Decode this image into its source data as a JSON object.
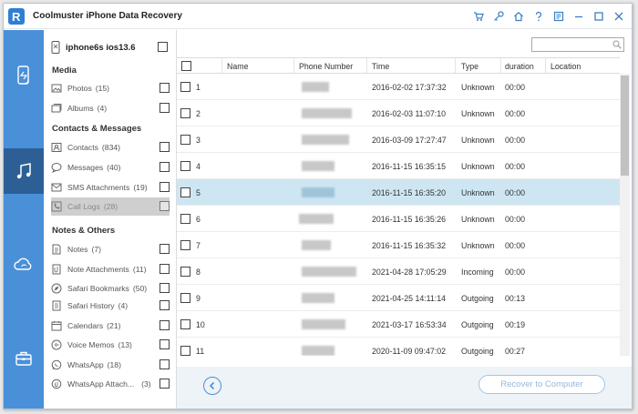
{
  "window": {
    "title": "Coolmuster iPhone Data Recovery"
  },
  "titlebar_icons": [
    "cart-icon",
    "key-icon",
    "home-icon",
    "help-icon",
    "feedback-icon",
    "minimize-icon",
    "maximize-icon",
    "close-icon"
  ],
  "leftbar": {
    "items": [
      "ios-device-icon",
      "music-itunes-icon",
      "cloud-icon",
      "toolbox-icon"
    ],
    "active": 1
  },
  "sidebar": {
    "device": "iphone6s ios13.6",
    "sections": [
      {
        "title": "Media",
        "items": [
          {
            "label": "Photos",
            "count": "(15)",
            "icon": "photos-icon"
          },
          {
            "label": "Albums",
            "count": "(4)",
            "icon": "albums-icon"
          }
        ]
      },
      {
        "title": "Contacts & Messages",
        "items": [
          {
            "label": "Contacts",
            "count": "(834)",
            "icon": "contacts-icon"
          },
          {
            "label": "Messages",
            "count": "(40)",
            "icon": "messages-icon"
          },
          {
            "label": "SMS Attachments",
            "count": "(19)",
            "icon": "sms-attachments-icon"
          },
          {
            "label": "Call Logs",
            "count": "(28)",
            "icon": "call-logs-icon",
            "selected": true
          }
        ]
      },
      {
        "title": "Notes & Others",
        "items": [
          {
            "label": "Notes",
            "count": "(7)",
            "icon": "notes-icon"
          },
          {
            "label": "Note Attachments",
            "count": "(11)",
            "icon": "note-attachments-icon"
          },
          {
            "label": "Safari Bookmarks",
            "count": "(50)",
            "icon": "safari-bookmarks-icon"
          },
          {
            "label": "Safari History",
            "count": "(4)",
            "icon": "safari-history-icon"
          },
          {
            "label": "Calendars",
            "count": "(21)",
            "icon": "calendars-icon"
          },
          {
            "label": "Voice Memos",
            "count": "(13)",
            "icon": "voice-memos-icon"
          },
          {
            "label": "WhatsApp",
            "count": "(18)",
            "icon": "whatsapp-icon"
          },
          {
            "label": "WhatsApp Attach...",
            "count": "(3)",
            "icon": "whatsapp-attachments-icon"
          }
        ]
      }
    ]
  },
  "table": {
    "columns": [
      "Name",
      "Phone Number",
      "Time",
      "Type",
      "duration",
      "Location"
    ],
    "rows": [
      {
        "num": "1",
        "name": "",
        "time": "2016-02-02 17:37:32",
        "type": "Unknown",
        "duration": "00:00",
        "location": ""
      },
      {
        "num": "2",
        "name": "",
        "time": "2016-02-03 11:07:10",
        "type": "Unknown",
        "duration": "00:00",
        "location": ""
      },
      {
        "num": "3",
        "name": "",
        "time": "2016-03-09 17:27:47",
        "type": "Unknown",
        "duration": "00:00",
        "location": ""
      },
      {
        "num": "4",
        "name": "",
        "time": "2016-11-15 16:35:15",
        "type": "Unknown",
        "duration": "00:00",
        "location": ""
      },
      {
        "num": "5",
        "name": "",
        "time": "2016-11-15 16:35:20",
        "type": "Unknown",
        "duration": "00:00",
        "location": "",
        "selected": true
      },
      {
        "num": "6",
        "name": "",
        "time": "2016-11-15 16:35:26",
        "type": "Unknown",
        "duration": "00:00",
        "location": ""
      },
      {
        "num": "7",
        "name": "",
        "time": "2016-11-15 16:35:32",
        "type": "Unknown",
        "duration": "00:00",
        "location": ""
      },
      {
        "num": "8",
        "name": "",
        "time": "2021-04-28 17:05:29",
        "type": "Incoming",
        "duration": "00:00",
        "location": ""
      },
      {
        "num": "9",
        "name": "",
        "time": "2021-04-25 14:11:14",
        "type": "Outgoing",
        "duration": "00:13",
        "location": ""
      },
      {
        "num": "10",
        "name": "",
        "time": "2021-03-17 16:53:34",
        "type": "Outgoing",
        "duration": "00:19",
        "location": ""
      },
      {
        "num": "11",
        "name": "",
        "time": "2020-11-09 09:47:02",
        "type": "Outgoing",
        "duration": "00:27",
        "location": ""
      }
    ]
  },
  "bottom": {
    "recover_label": "Recover to Computer"
  },
  "colors": {
    "accent": "#4a90d9",
    "active_nav": "#2d5f96",
    "selected_row": "#cde6f2"
  }
}
